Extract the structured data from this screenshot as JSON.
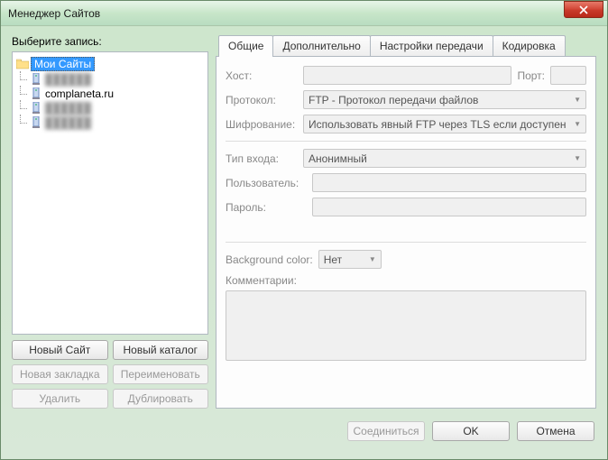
{
  "window": {
    "title": "Менеджер Сайтов"
  },
  "left": {
    "label": "Выберите запись:",
    "root": "Мои Сайты",
    "items": [
      {
        "label": "██████"
      },
      {
        "label": "complaneta.ru"
      },
      {
        "label": "██████"
      },
      {
        "label": "██████"
      }
    ],
    "buttons": {
      "new_site": "Новый Сайт",
      "new_folder": "Новый каталог",
      "new_bookmark": "Новая закладка",
      "rename": "Переименовать",
      "delete": "Удалить",
      "duplicate": "Дублировать"
    }
  },
  "tabs": [
    "Общие",
    "Дополнительно",
    "Настройки передачи",
    "Кодировка"
  ],
  "general": {
    "host_label": "Хост:",
    "port_label": "Порт:",
    "protocol_label": "Протокол:",
    "protocol_value": "FTP - Протокол передачи файлов",
    "encryption_label": "Шифрование:",
    "encryption_value": "Использовать явный FTP через TLS если доступен",
    "logon_label": "Тип входа:",
    "logon_value": "Анонимный",
    "user_label": "Пользователь:",
    "pass_label": "Пароль:",
    "bg_label": "Background color:",
    "bg_value": "Нет",
    "comments_label": "Комментарии:"
  },
  "footer": {
    "connect": "Соединиться",
    "ok": "OK",
    "cancel": "Отмена"
  }
}
